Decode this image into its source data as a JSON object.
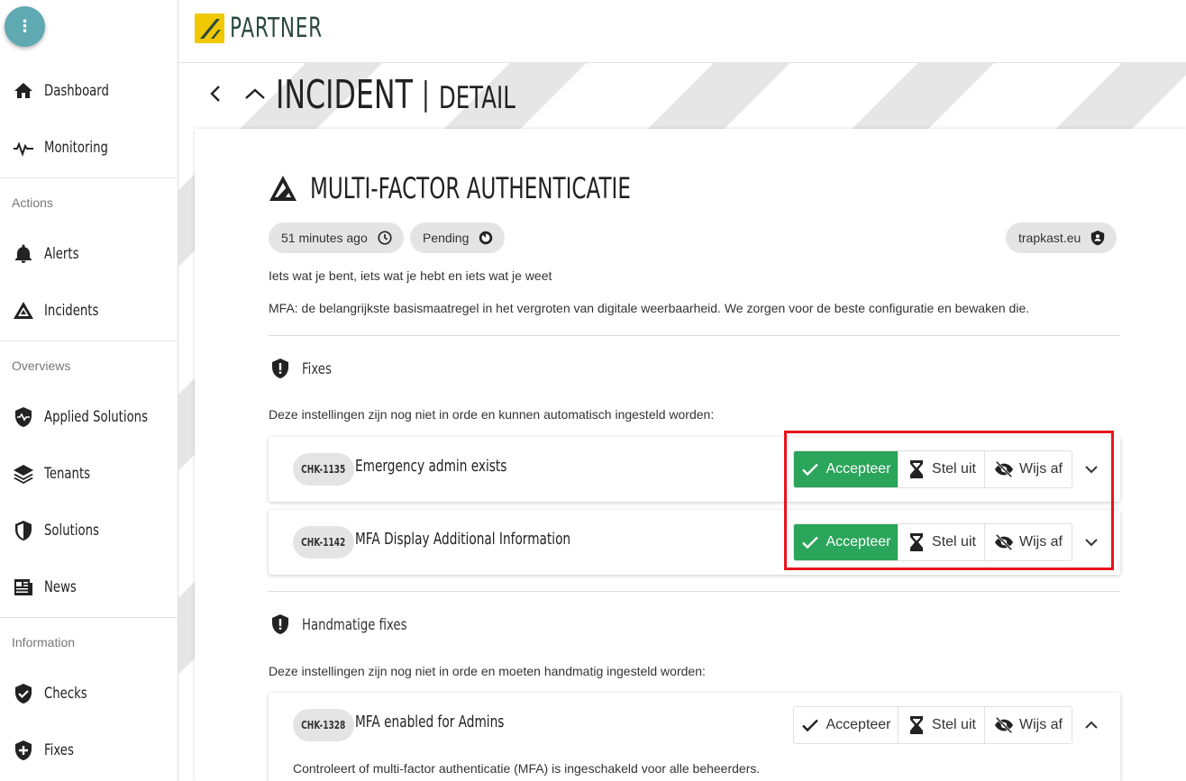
{
  "sidebar": {
    "menu_icon": "more-vert-icon",
    "items_top": [
      {
        "label": "Dashboard",
        "icon": "home-icon"
      },
      {
        "label": "Monitoring",
        "icon": "pulse-icon"
      }
    ],
    "sections": [
      {
        "title": "Actions",
        "items": [
          {
            "label": "Alerts",
            "icon": "bell-icon"
          },
          {
            "label": "Incidents",
            "icon": "warning-triangle-icon"
          }
        ]
      },
      {
        "title": "Overviews",
        "items": [
          {
            "label": "Applied Solutions",
            "icon": "shield-pulse-icon"
          },
          {
            "label": "Tenants",
            "icon": "layers-icon"
          },
          {
            "label": "Solutions",
            "icon": "shield-half-icon"
          },
          {
            "label": "News",
            "icon": "newspaper-icon"
          }
        ]
      },
      {
        "title": "Information",
        "items": [
          {
            "label": "Checks",
            "icon": "shield-check-icon"
          },
          {
            "label": "Fixes",
            "icon": "shield-plus-icon"
          }
        ]
      }
    ]
  },
  "header": {
    "logo_text": "PARTNER",
    "logo_color": "#f0c800"
  },
  "page": {
    "title": "INCIDENT",
    "separator": "|",
    "subtitle": "DETAIL"
  },
  "incident": {
    "title": "MULTI-FACTOR AUTHENTICATIE",
    "chips": {
      "time": "51 minutes ago",
      "status": "Pending",
      "tenant": "trapkast.eu"
    },
    "tagline": "Iets wat je bent, iets wat je hebt en iets wat je weet",
    "description": "MFA: de belangrijkste basismaatregel in het vergroten van digitale weerbaarheid. We zorgen voor de beste configuratie en bewaken die."
  },
  "fixes": {
    "title": "Fixes",
    "description": "Deze instellingen zijn nog niet in orde en kunnen automatisch ingesteld worden:",
    "rows": [
      {
        "id": "CHK-1135",
        "name": "Emergency admin exists"
      },
      {
        "id": "CHK-1142",
        "name": "MFA Display Additional Information"
      }
    ]
  },
  "manual_fixes": {
    "title": "Handmatige fixes",
    "description": "Deze instellingen zijn nog niet in orde en moeten handmatig ingesteld worden:",
    "rows": [
      {
        "id": "CHK-1328",
        "name": "MFA enabled for Admins",
        "detail": "Controleert of multi-factor authenticatie (MFA) is ingeschakeld voor alle beheerders."
      }
    ]
  },
  "actions": {
    "accept": "Accepteer",
    "postpone": "Stel uit",
    "dismiss": "Wijs af"
  },
  "colors": {
    "accept_primary": "#2aa55a",
    "highlight": "#e8141c",
    "fab": "#5fa9b3"
  }
}
